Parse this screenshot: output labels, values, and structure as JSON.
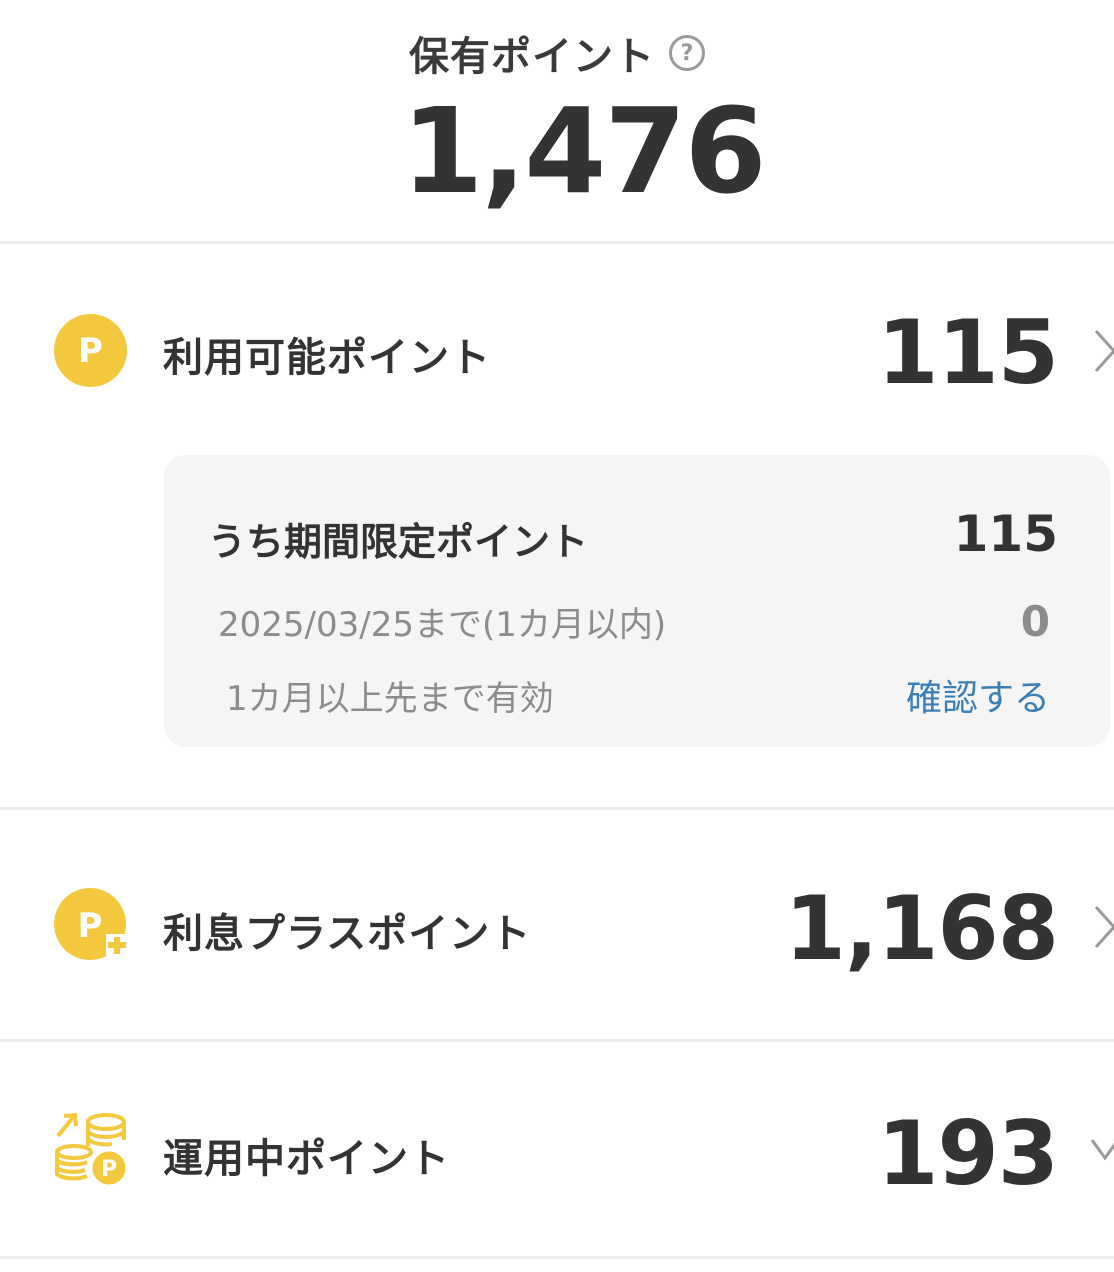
{
  "header": {
    "title": "保有ポイント",
    "help_glyph": "?",
    "total": "1,476"
  },
  "available": {
    "icon": "P",
    "label": "利用可能ポイント",
    "value": "115",
    "limited": {
      "title": "うち期間限定ポイント",
      "value": "115",
      "soon_label": "2025/03/25まで(1カ月以内)",
      "soon_value": "0",
      "later_label": "1カ月以上先まで有効",
      "confirm_link": "確認する"
    }
  },
  "interest": {
    "icon": "P",
    "label": "利息プラスポイント",
    "value": "1,168"
  },
  "investing": {
    "label": "運用中ポイント",
    "value": "193"
  },
  "colors": {
    "coin": "#f4c93d",
    "link": "#3b7fb7",
    "text": "#333333",
    "muted": "#8c8c8c"
  },
  "icons": {
    "help": "question-circle-icon",
    "point_coin": "p-coin-icon",
    "interest_coin": "p-plus-coin-icon",
    "investing": "coin-stack-up-icon",
    "chevron_right": "chevron-right-icon",
    "chevron_down": "chevron-down-icon"
  }
}
